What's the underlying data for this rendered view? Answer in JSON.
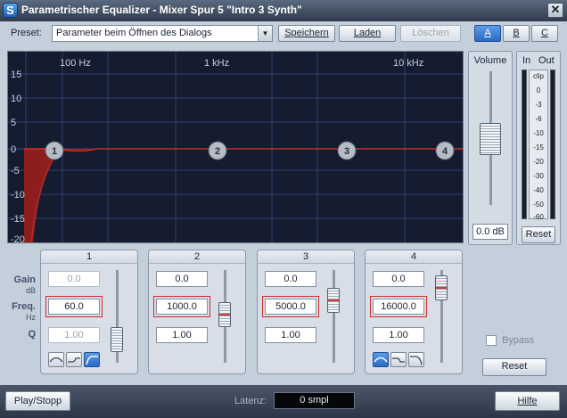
{
  "window": {
    "title": "Parametrischer Equalizer - Mixer Spur 5 \"Intro 3 Synth\"",
    "app_icon_letter": "S",
    "close_symbol": "✕"
  },
  "preset": {
    "label": "Preset:",
    "value": "Parameter beim Öffnen des Dialogs",
    "save": "Speichern",
    "load": "Laden",
    "delete": "Löschen"
  },
  "ab": [
    "A",
    "B",
    "C"
  ],
  "graph": {
    "freq_labels": [
      "100 Hz",
      "1 kHz",
      "10 kHz"
    ],
    "db_labels": [
      "15",
      "10",
      "5",
      "0",
      "-5",
      "-10",
      "-15",
      "-20"
    ],
    "bands": [
      "1",
      "2",
      "3",
      "4"
    ]
  },
  "volume": {
    "label": "Volume",
    "value": "0.0 dB",
    "level_db": 0.0
  },
  "meter": {
    "in_label": "In",
    "out_label": "Out",
    "scale": [
      "clip",
      "0",
      "-3",
      "-6",
      "-10",
      "-15",
      "-20",
      "-30",
      "-40",
      "-50",
      "-60"
    ],
    "reset": "Reset"
  },
  "row_labels": {
    "gain": "Gain",
    "gain_unit": "dB",
    "freq": "Freq.",
    "freq_unit": "Hz",
    "q": "Q"
  },
  "bands": [
    {
      "title": "1",
      "gain": "0.0",
      "freq": "60.0",
      "q": "1.00",
      "gain_enabled": false,
      "q_enabled": false
    },
    {
      "title": "2",
      "gain": "0.0",
      "freq": "1000.0",
      "q": "1.00",
      "gain_enabled": true,
      "q_enabled": true
    },
    {
      "title": "3",
      "gain": "0.0",
      "freq": "5000.0",
      "q": "1.00",
      "gain_enabled": true,
      "q_enabled": true
    },
    {
      "title": "4",
      "gain": "0.0",
      "freq": "16000.0",
      "q": "1.00",
      "gain_enabled": true,
      "q_enabled": false
    }
  ],
  "bypass": {
    "label": "Bypass",
    "checked": false
  },
  "reset_label": "Reset",
  "bottom": {
    "play": "Play/Stopp",
    "latency_label": "Latenz:",
    "latency_value": "0 smpl",
    "help": "Hilfe"
  },
  "colors": {
    "graph_bg": "#151c2f",
    "grid": "#2e3f72",
    "curve": "#c42b2b",
    "fill": "#8e1d1d",
    "accent": "#2b69c4"
  }
}
